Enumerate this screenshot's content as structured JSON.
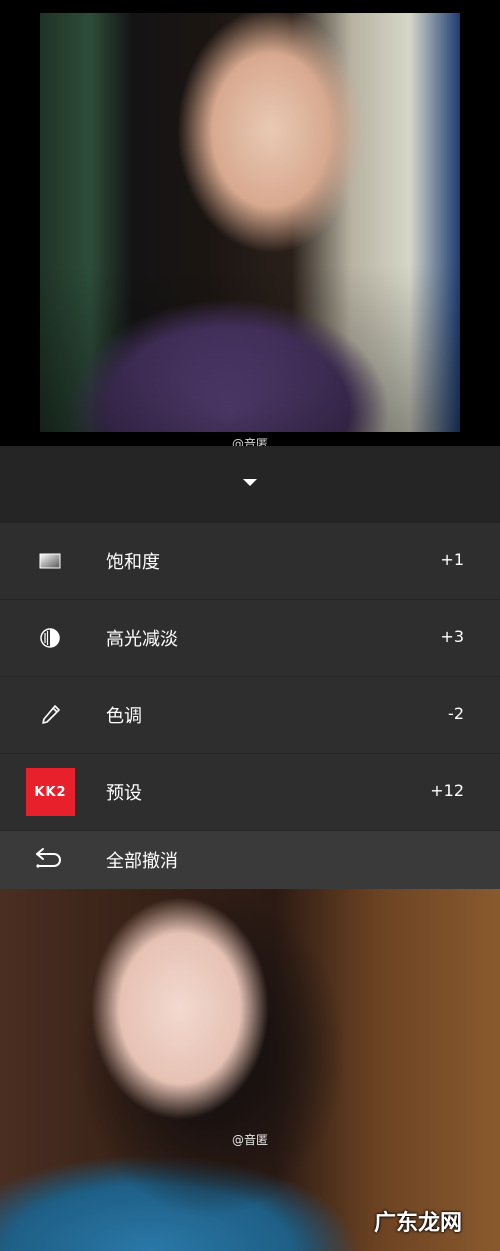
{
  "photo_top": {
    "watermark": "@音匿"
  },
  "panel": {
    "rows": [
      {
        "icon": "saturation-icon",
        "label": "饱和度",
        "value": "+1"
      },
      {
        "icon": "highlight-fade-icon",
        "label": "高光减淡",
        "value": "+3"
      },
      {
        "icon": "tone-pen-icon",
        "label": "色调",
        "value": "-2"
      },
      {
        "icon": "preset-icon",
        "label": "预设",
        "value": "+12",
        "badge": "KK2"
      }
    ],
    "undo": {
      "icon": "undo-icon",
      "label": "全部撤消"
    }
  },
  "photo_bottom": {
    "watermark": "@音匿",
    "site_logo": "广东龙网"
  },
  "colors": {
    "badge_red": "#e8202b",
    "panel_bg": "#2e2e2e",
    "undo_bg": "#3a3a3a"
  }
}
